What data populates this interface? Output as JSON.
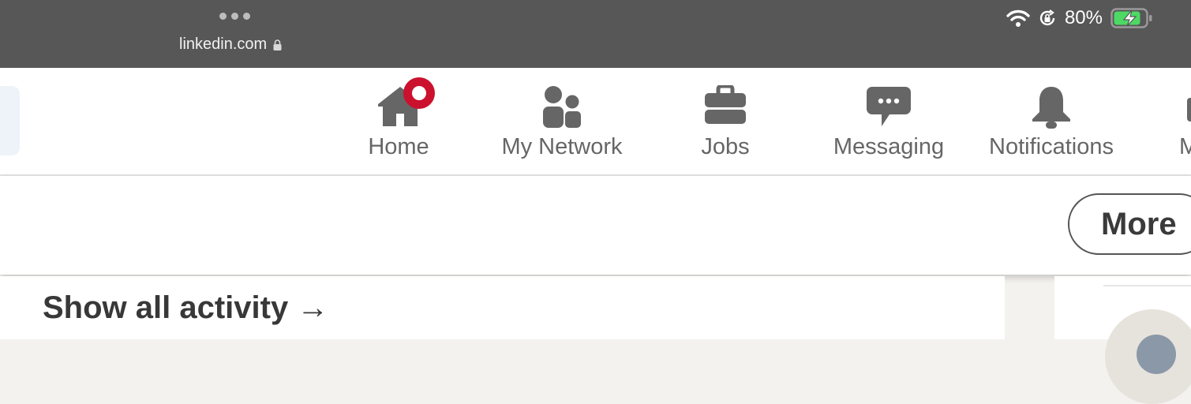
{
  "status_bar": {
    "url": "linkedin.com",
    "battery": "80%",
    "icons": [
      "more-dots-icon",
      "lock-icon",
      "wifi-icon",
      "orientation-lock-icon",
      "battery-charging-icon"
    ]
  },
  "nav": {
    "items": [
      {
        "label": "Home",
        "icon": "home-icon",
        "notification": true
      },
      {
        "label": "My Network",
        "icon": "network-icon"
      },
      {
        "label": "Jobs",
        "icon": "briefcase-icon"
      },
      {
        "label": "Messaging",
        "icon": "message-icon"
      },
      {
        "label": "Notifications",
        "icon": "bell-icon"
      }
    ],
    "cut_label": "M"
  },
  "subheader": {
    "more_label": "More"
  },
  "content": {
    "show_activity": "Show all activity →"
  },
  "colors": {
    "status_bg": "#575757",
    "nav_text": "#666666",
    "badge": "#cb112d",
    "page_bg": "#f4f2ee"
  }
}
